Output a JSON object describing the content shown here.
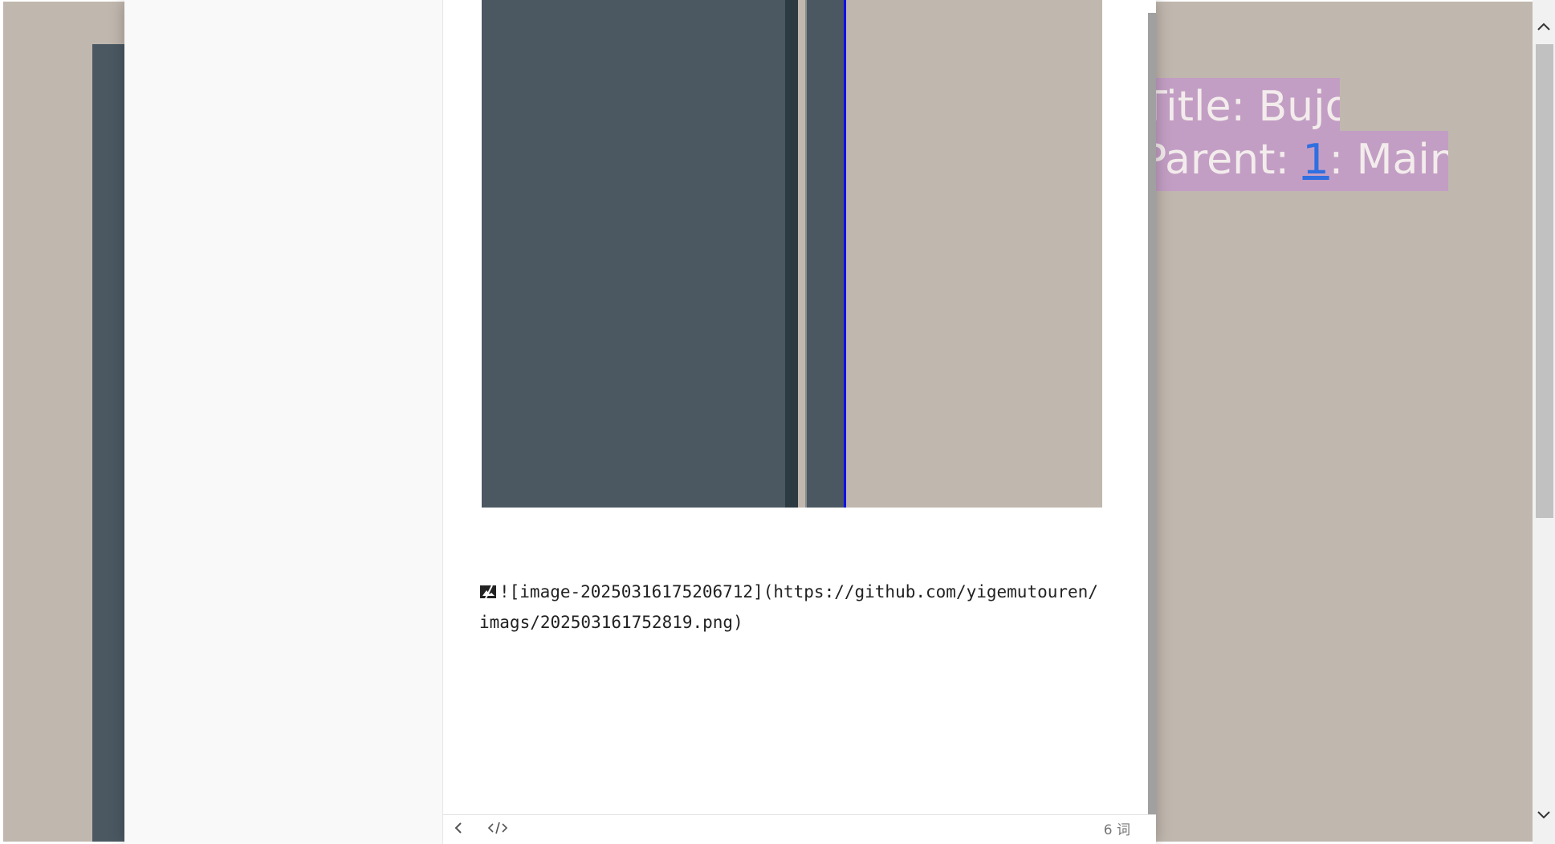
{
  "background": {
    "label_title": "Title: Bujo",
    "label_parent_prefix": "Parent: ",
    "label_parent_link": "1",
    "label_parent_suffix": ": Main"
  },
  "editor": {
    "markdown_source": "![image-20250316175206712](https://github.com/yigemutouren/imags/202503161752819.png)"
  },
  "status_bar": {
    "back_icon": "chevron-left-icon",
    "source_icon": "code-icon",
    "word_count": "6 词"
  },
  "page_scrollbar": {
    "up_icon": "chevron-up-icon",
    "down_icon": "chevron-down-icon"
  },
  "colors": {
    "canvas_beige": "#c0b7ae",
    "slate": "#4b5862",
    "label_purple": "#c39ec4",
    "link_blue": "#2f6fe0",
    "cursor_blue": "#1010e6"
  }
}
